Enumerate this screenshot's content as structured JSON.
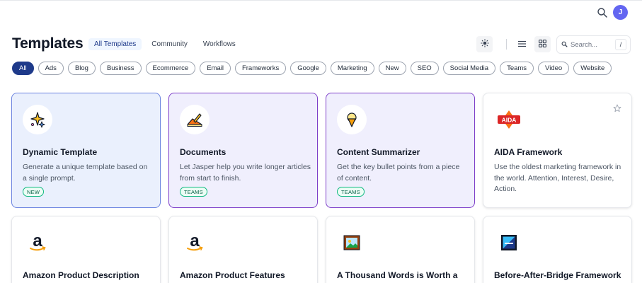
{
  "header": {
    "avatar_initial": "J",
    "search_icon": "search-icon"
  },
  "page": {
    "title": "Templates"
  },
  "tabs": [
    {
      "label": "All Templates",
      "active": true
    },
    {
      "label": "Community",
      "active": false
    },
    {
      "label": "Workflows",
      "active": false
    }
  ],
  "toolbar": {
    "theme_icon": "sun-icon",
    "list_icon": "list-view-icon",
    "grid_icon": "grid-view-icon",
    "search_placeholder": "Search...",
    "search_shortcut": "/"
  },
  "filters": [
    "All",
    "Ads",
    "Blog",
    "Business",
    "Ecommerce",
    "Email",
    "Frameworks",
    "Google",
    "Marketing",
    "New",
    "SEO",
    "Social Media",
    "Teams",
    "Video",
    "Website"
  ],
  "active_filter": "All",
  "cards": [
    {
      "title": "Dynamic Template",
      "description": "Generate a unique template based on a single prompt.",
      "badge": "NEW",
      "icon": "sparkle-icon"
    },
    {
      "title": "Documents",
      "description": "Let Jasper help you write longer articles from start to finish.",
      "badge": "TEAMS",
      "icon": "pencil-document-icon"
    },
    {
      "title": "Content Summarizer",
      "description": "Get the key bullet points from a piece of content.",
      "badge": "TEAMS",
      "icon": "ice-cream-icon"
    },
    {
      "title": "AIDA Framework",
      "description": "Use the oldest marketing framework in the world. Attention, Interest, Desire, Action.",
      "badge": "",
      "icon": "aida-logo-icon",
      "logo_text": "AIDA"
    },
    {
      "title": "Amazon Product Description",
      "description": "",
      "badge": "",
      "icon": "amazon-icon"
    },
    {
      "title": "Amazon Product Features",
      "description": "",
      "badge": "",
      "icon": "amazon-icon"
    },
    {
      "title": "A Thousand Words is Worth a",
      "description": "",
      "badge": "",
      "icon": "picture-icon"
    },
    {
      "title": "Before-After-Bridge Framework",
      "description": "",
      "badge": "",
      "icon": "bridge-picture-icon"
    }
  ],
  "colors": {
    "accent": "#1e3a8a",
    "avatar": "#6366f1",
    "dynamic_border": "#6b83e0",
    "teams_border": "#7e3fc9",
    "badge_green": "#10b981"
  }
}
